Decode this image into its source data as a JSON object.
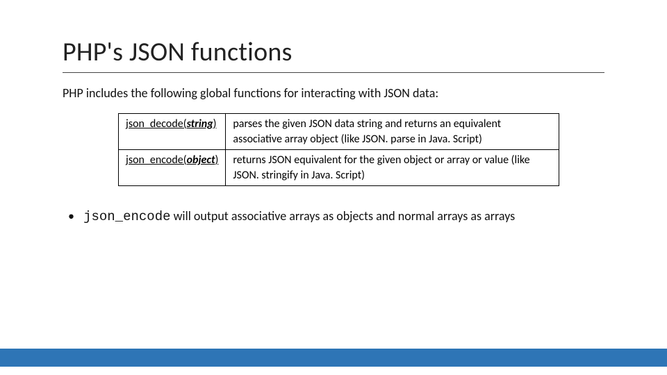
{
  "title": "PHP's JSON functions",
  "intro": "PHP includes the following global functions for interacting with JSON data:",
  "rows": [
    {
      "fn_prefix": "json_decode(",
      "fn_arg": "string",
      "fn_suffix": ")",
      "desc": "parses the given JSON data string and returns an equivalent associative array object (like JSON. parse in Java. Script)"
    },
    {
      "fn_prefix": "json_encode(",
      "fn_arg": "object",
      "fn_suffix": ")",
      "desc": "returns JSON equivalent for the given object or array or value (like JSON. stringify in Java. Script)"
    }
  ],
  "bullet": {
    "dot": "•",
    "code": "json_encode",
    "rest": " will output associative arrays as objects and normal arrays as arrays"
  }
}
